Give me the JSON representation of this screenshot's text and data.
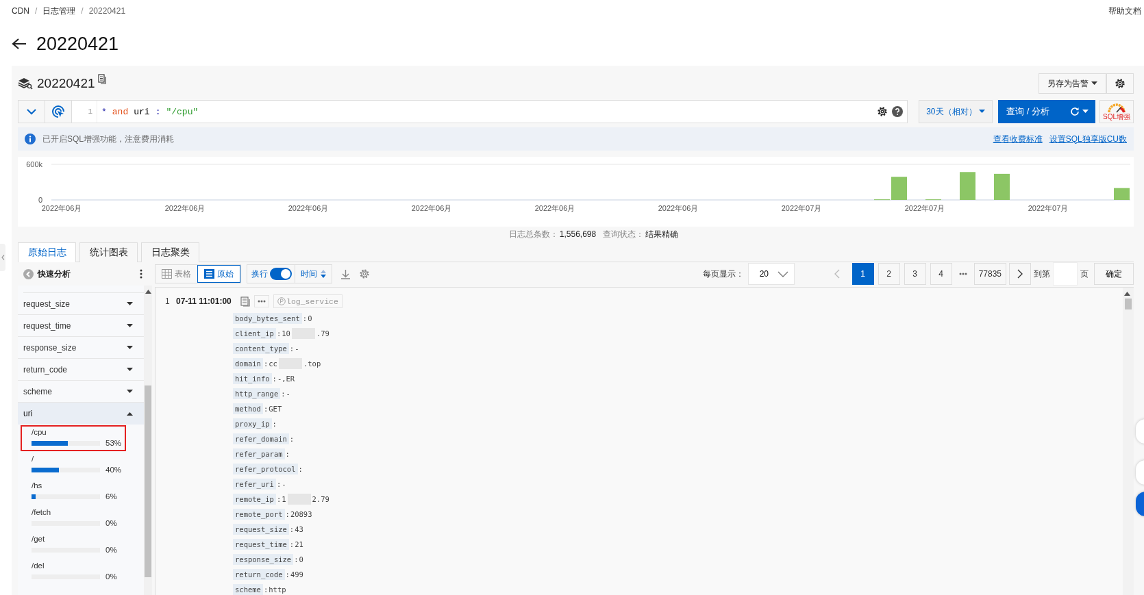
{
  "breadcrumb": [
    {
      "label": "CDN"
    },
    {
      "separator": "/",
      "label": "日志管理"
    },
    {
      "separator": "/",
      "label": "20220421"
    }
  ],
  "help_link": "帮助文档",
  "page_title": "20220421",
  "logstore": {
    "name": "20220421",
    "save_alert": "另存为告警"
  },
  "query": {
    "line_number": "1",
    "tokens": [
      {
        "text": "*",
        "kind": "operator"
      },
      {
        "text": "and",
        "kind": "keyword"
      },
      {
        "text": "uri",
        "kind": "field"
      },
      {
        "text": ":",
        "kind": "punct"
      },
      {
        "text": "\"/cpu\"",
        "kind": "string"
      }
    ],
    "time_range": "30天（相对）",
    "search_button": "查询 / 分析",
    "sql_badge": "SQL增强"
  },
  "notice": {
    "text": "已开启SQL增强功能，注意费用消耗",
    "links": [
      "查看收费标准",
      "设置SQL独享版CU数"
    ]
  },
  "histogram": {
    "axis_labels": [
      "2022年06月",
      "2022年06月",
      "2022年06月",
      "2022年06月",
      "2022年06月",
      "2022年06月",
      "2022年07月",
      "2022年07月",
      "2022年07月"
    ],
    "chart_data": {
      "type": "bar",
      "ylim": [
        0,
        600000
      ],
      "yticks": [
        0,
        {
          "value": 600000,
          "label": "600k"
        }
      ],
      "series": [
        {
          "color": "#8cc665",
          "values": [
            null,
            null,
            null,
            null,
            null,
            null,
            null,
            null,
            null,
            null,
            null,
            null,
            null,
            null,
            null,
            null,
            null,
            null,
            null,
            null,
            null,
            null,
            null,
            null,
            null,
            null,
            null,
            null,
            null,
            null,
            null,
            null,
            null,
            null,
            null,
            null,
            null,
            null,
            null,
            null,
            null,
            null,
            null,
            null,
            null,
            null,
            null,
            null,
            10000,
            390000,
            null,
            10000,
            null,
            470000,
            null,
            440000,
            null,
            null,
            null,
            null,
            null,
            null,
            200000
          ]
        }
      ]
    }
  },
  "stats": [
    {
      "label": "日志总条数：",
      "value": "1,556,698"
    },
    {
      "label": "查询状态：",
      "value": "结果精确"
    }
  ],
  "tabs": [
    {
      "label": "原始日志",
      "selected": true
    },
    {
      "label": "统计图表",
      "selected": false
    },
    {
      "label": "日志聚类",
      "selected": false
    }
  ],
  "quick_analysis": {
    "title": "快速分析",
    "fields": [
      {
        "name": "request_size",
        "expanded": false
      },
      {
        "name": "request_time",
        "expanded": false
      },
      {
        "name": "response_size",
        "expanded": false
      },
      {
        "name": "return_code",
        "expanded": false
      },
      {
        "name": "scheme",
        "expanded": false
      },
      {
        "name": "uri",
        "expanded": true,
        "values": [
          {
            "label": "/cpu",
            "percent": "53%",
            "level": 0.53,
            "highlighted": true
          },
          {
            "label": "/",
            "percent": "40%",
            "level": 0.4,
            "highlighted": false
          },
          {
            "label": "/hs",
            "percent": "6%",
            "level": 0.06,
            "highlighted": false
          },
          {
            "label": "/fetch",
            "percent": "0%",
            "level": 0,
            "highlighted": false
          },
          {
            "label": "/get",
            "percent": "0%",
            "level": 0,
            "highlighted": false
          },
          {
            "label": "/del",
            "percent": "0%",
            "level": 0,
            "highlighted": false
          }
        ]
      }
    ]
  },
  "toolbar": {
    "view_modes": [
      {
        "label": "表格",
        "kind": "table",
        "selected": false
      },
      {
        "label": "原始",
        "kind": "raw",
        "selected": true
      }
    ],
    "wrap": {
      "label": "换行",
      "on": true
    },
    "sort": "时间"
  },
  "pagination": {
    "page_size_label": "每页显示：",
    "page_size": "20",
    "prev_disabled": true,
    "pages": [
      {
        "label": "1",
        "selected": true
      },
      {
        "label": "2",
        "selected": false
      },
      {
        "label": "3",
        "selected": false
      },
      {
        "label": "4",
        "selected": false
      },
      {
        "kind": "ellipsis"
      },
      {
        "label": "77835",
        "selected": false
      }
    ],
    "goto_label": "到第",
    "page_unit": "页",
    "confirm": "确定"
  },
  "log": {
    "index": "1",
    "time": "07-11 11:01:00",
    "source": "log_service",
    "fields": [
      {
        "key": "body_bytes_sent",
        "colon": ":",
        "value": "0"
      },
      {
        "key": "client_ip",
        "colon": ":",
        "value": "10",
        "masked": true,
        "value_after": ".79"
      },
      {
        "key": "content_type",
        "colon": ":",
        "value": "-"
      },
      {
        "key": "domain",
        "colon": ":",
        "value": "cc",
        "masked": true,
        "value_after": ".top"
      },
      {
        "key": "hit_info",
        "colon": ":",
        "value": "-,ER"
      },
      {
        "key": "http_range",
        "colon": ":",
        "value": "-"
      },
      {
        "key": "method",
        "colon": ":",
        "value": "GET"
      },
      {
        "key": "proxy_ip",
        "colon": ":"
      },
      {
        "key": "refer_domain",
        "colon": ":"
      },
      {
        "key": "refer_param",
        "colon": ":"
      },
      {
        "key": "refer_protocol",
        "colon": ":"
      },
      {
        "key": "refer_uri",
        "colon": ":",
        "value": "-"
      },
      {
        "key": "remote_ip",
        "colon": ":",
        "value": "1",
        "masked": true,
        "value_after": "2.79"
      },
      {
        "key": "remote_port",
        "colon": ":",
        "value": "20893"
      },
      {
        "key": "request_size",
        "colon": ":",
        "value": "43"
      },
      {
        "key": "request_time",
        "colon": ":",
        "value": "21"
      },
      {
        "key": "response_size",
        "colon": ":",
        "value": "0"
      },
      {
        "key": "return_code",
        "colon": ":",
        "value": "499"
      },
      {
        "key": "scheme",
        "colon": ":",
        "value": "http"
      }
    ]
  }
}
